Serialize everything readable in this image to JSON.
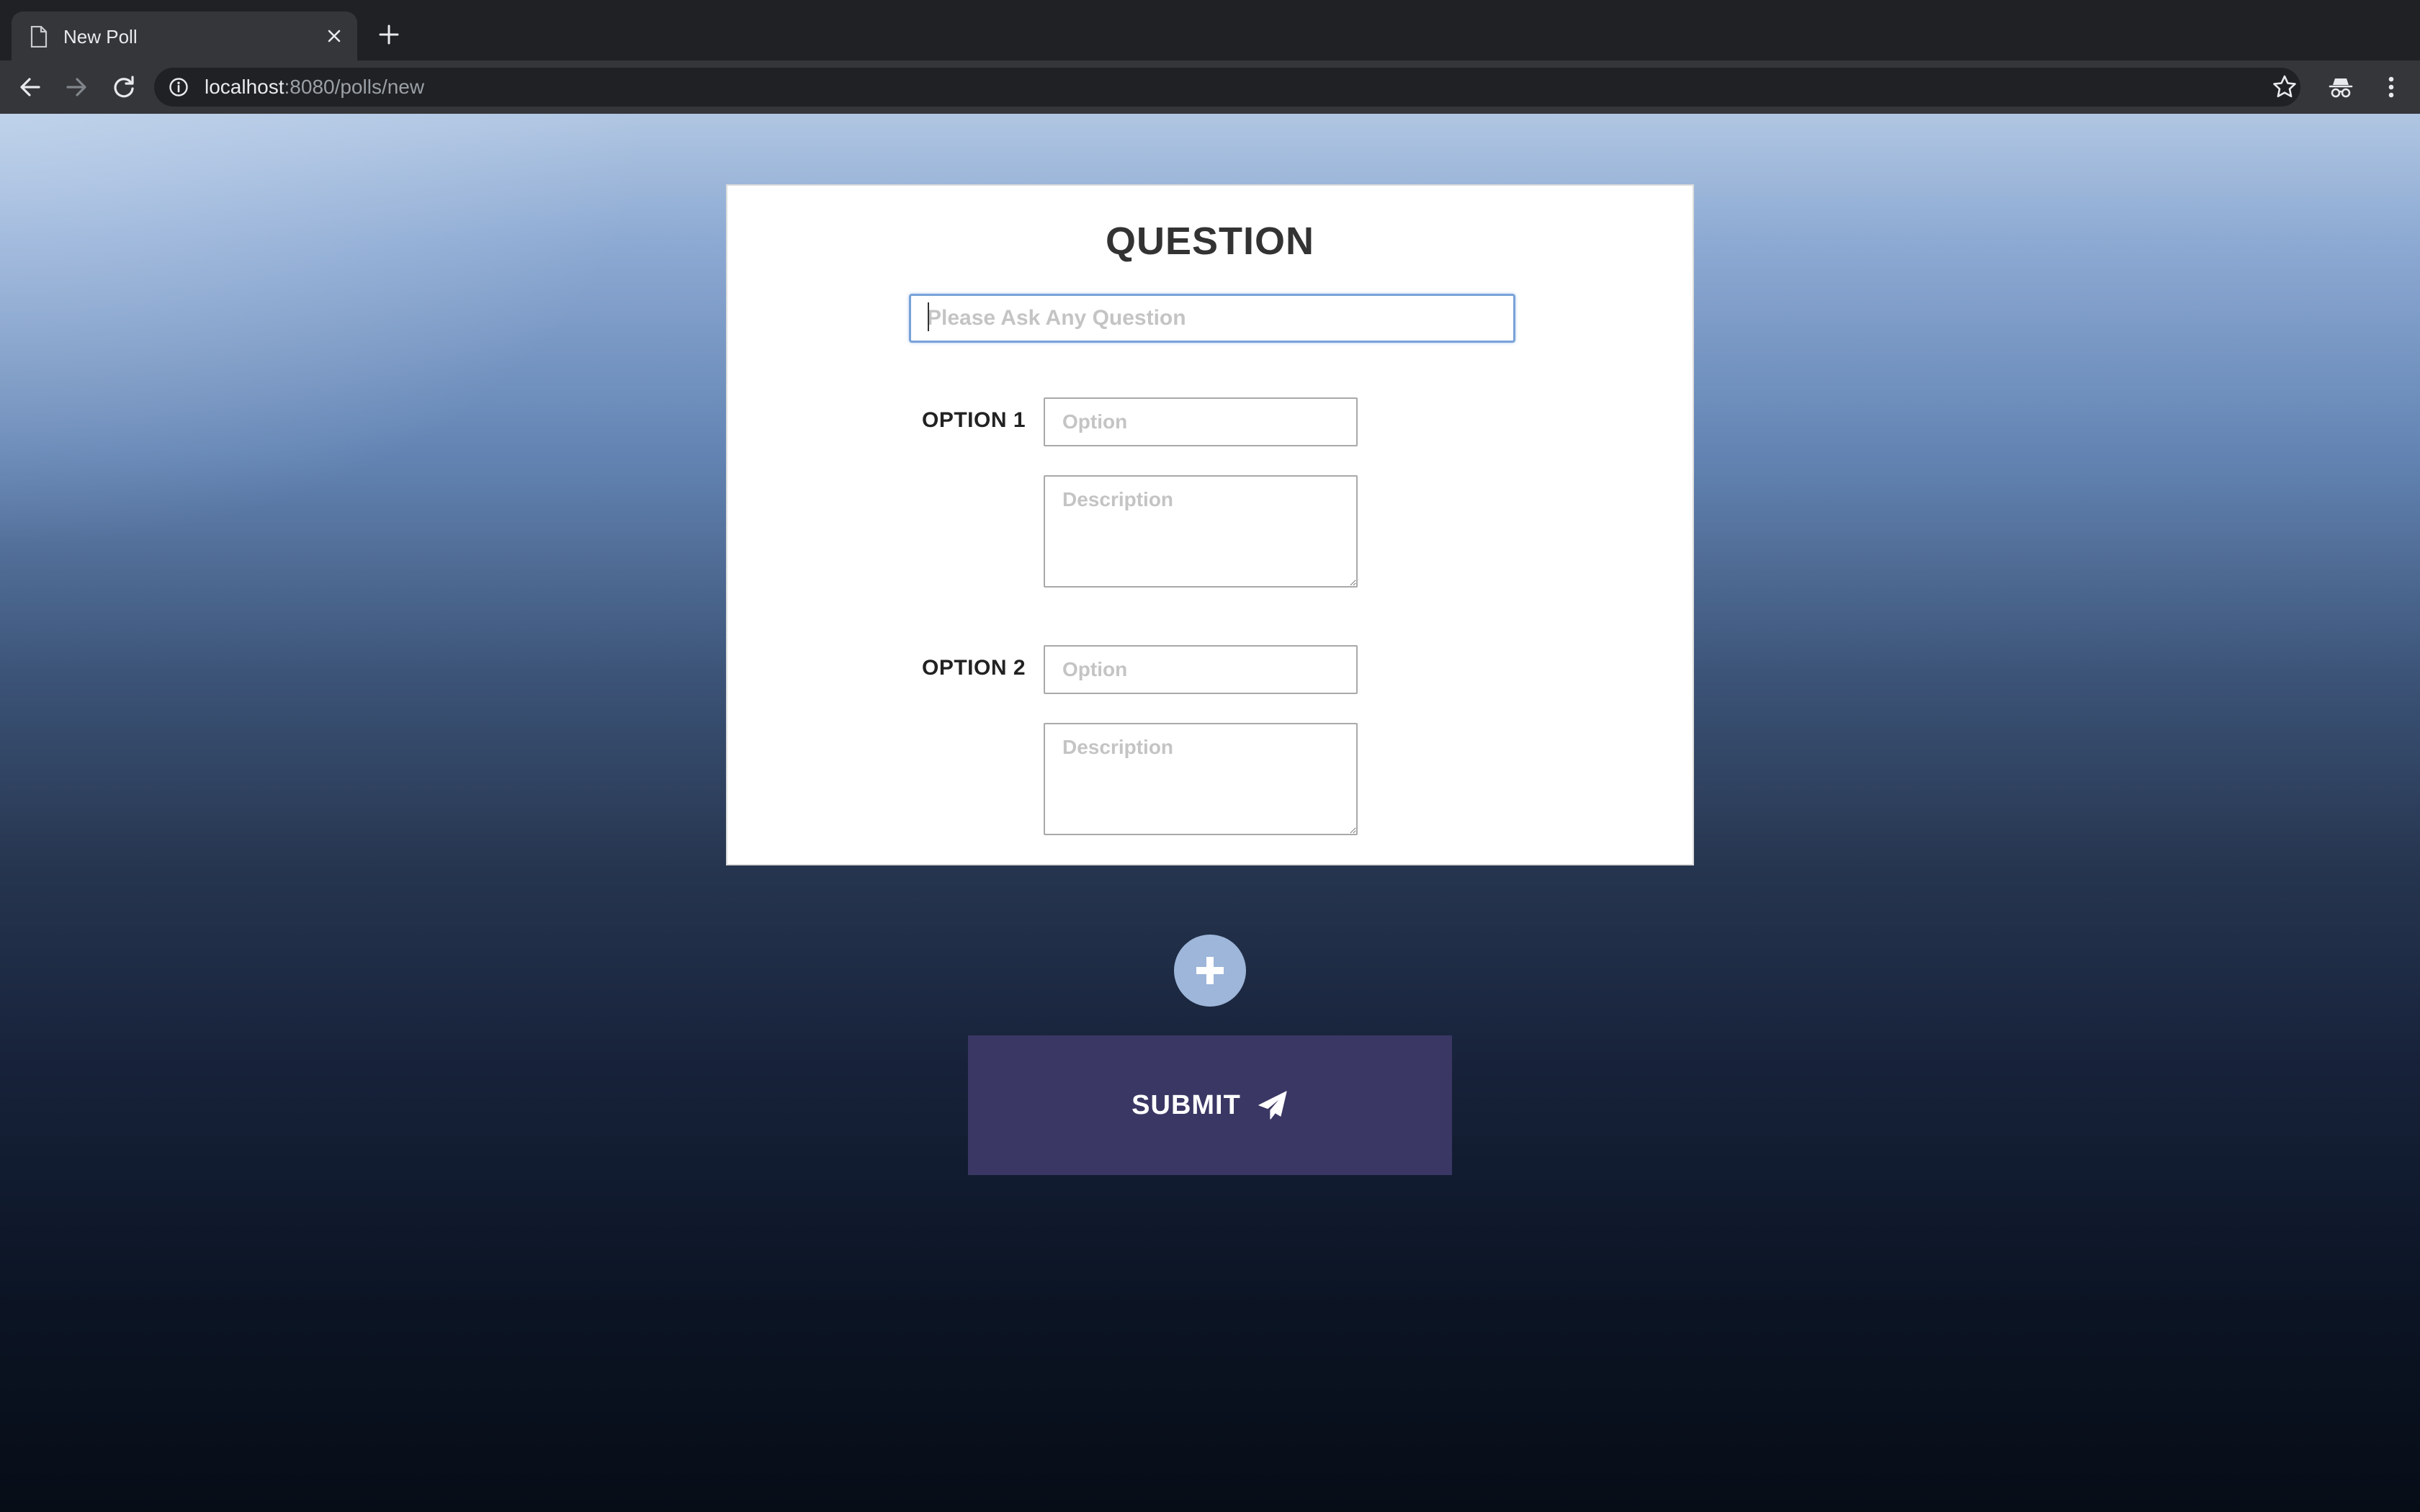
{
  "browser": {
    "tab_title": "New Poll",
    "url_host": "localhost",
    "url_path": ":8080/polls/new"
  },
  "poll": {
    "heading": "QUESTION",
    "question_placeholder": "Please Ask Any Question",
    "options": [
      {
        "label": "OPTION 1",
        "option_placeholder": "Option",
        "description_placeholder": "Description"
      },
      {
        "label": "OPTION 2",
        "option_placeholder": "Option",
        "description_placeholder": "Description"
      }
    ],
    "submit_label": "SUBMIT"
  },
  "colors": {
    "card": "#ffffff",
    "submit_button": "#3a3764",
    "add_button": "#9db6d9",
    "focus_border": "#79a2d8"
  },
  "icons": {
    "tab": "document-icon",
    "add": "plus-icon",
    "submit": "paper-plane-icon"
  }
}
